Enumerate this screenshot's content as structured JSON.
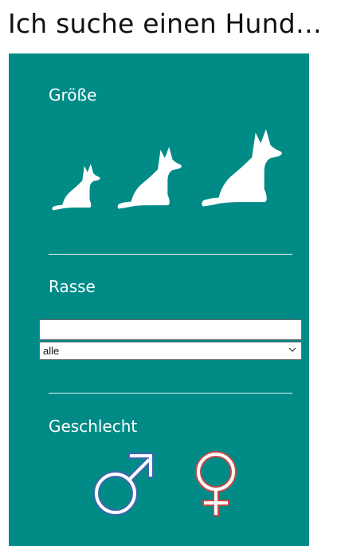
{
  "header": {
    "title": "Ich suche einen Hund…"
  },
  "size_section": {
    "label": "Größe",
    "options": [
      {
        "icon": "small-dog-icon"
      },
      {
        "icon": "medium-dog-icon"
      },
      {
        "icon": "large-dog-icon"
      }
    ]
  },
  "breed_section": {
    "label": "Rasse",
    "search_value": "",
    "select_value": "alle"
  },
  "gender_section": {
    "label": "Geschlecht",
    "male_icon": "male-symbol-icon",
    "female_icon": "female-symbol-icon"
  },
  "colors": {
    "panel": "#008b87",
    "male": "#3f66b0",
    "female": "#c24a4a"
  }
}
